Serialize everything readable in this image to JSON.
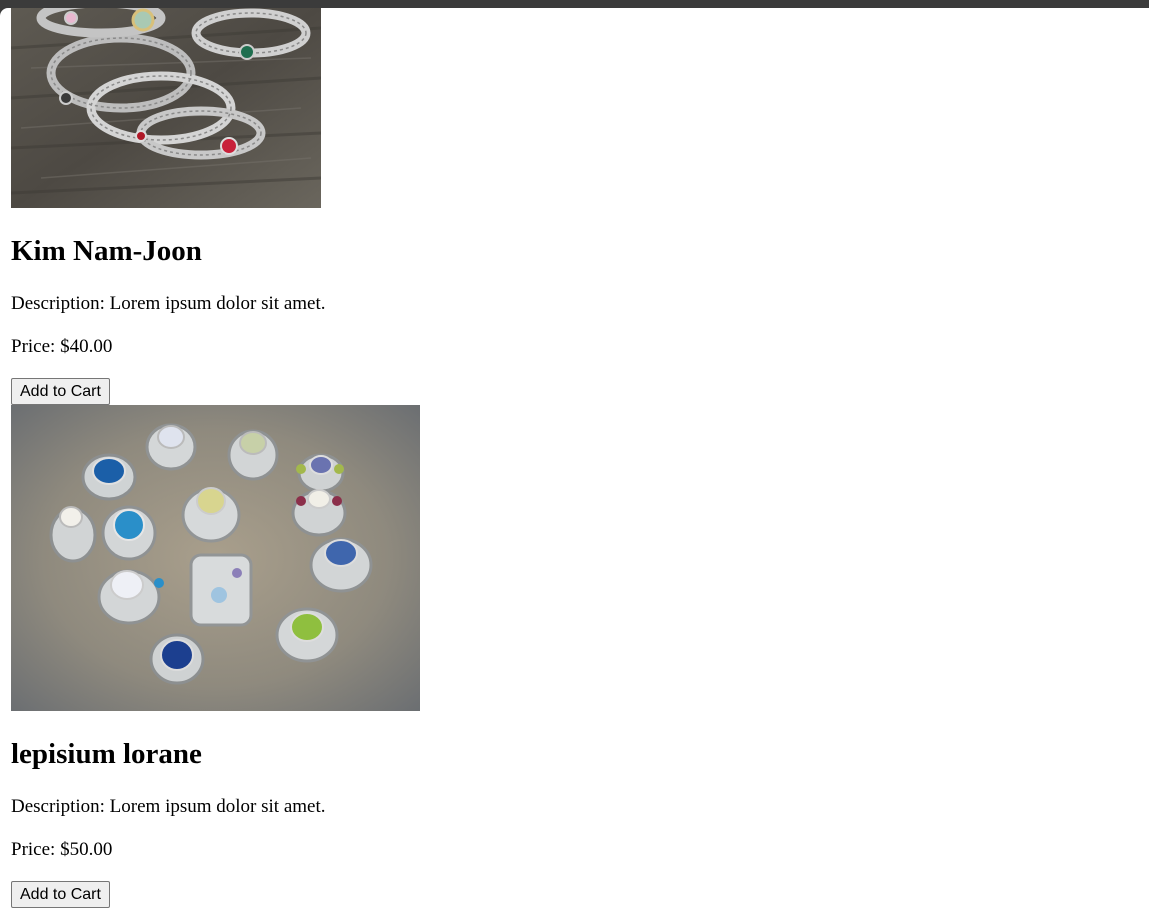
{
  "products": [
    {
      "image": "silver-bangle-bracelets-with-gemstones",
      "name": "Kim Nam-Joon",
      "description": "Description: Lorem ipsum dolor sit amet.",
      "price": "Price: $40.00",
      "button_label": "Add to Cart"
    },
    {
      "image": "silver-gemstone-rings",
      "name": "lepisium lorane",
      "description": "Description: Lorem ipsum dolor sit amet.",
      "price": "Price: $50.00",
      "button_label": "Add to Cart"
    }
  ],
  "colors": {
    "page_background": "#ffffff",
    "chrome_background": "#3b3b3b",
    "button_background": "#efefef",
    "button_border": "#767676"
  }
}
